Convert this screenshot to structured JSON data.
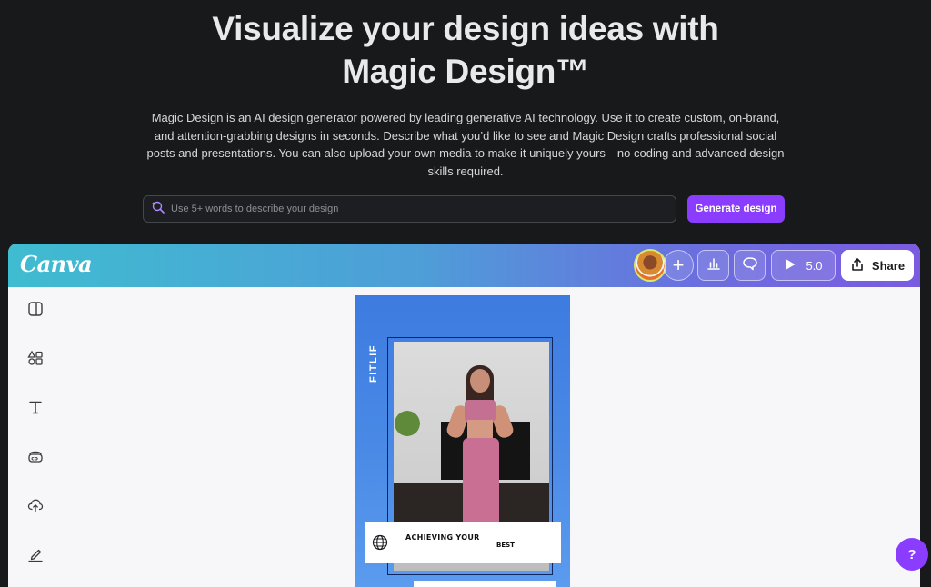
{
  "hero": {
    "title_line1": "Visualize your design ideas with",
    "title_line2": "Magic Design™",
    "description": "Magic Design is an AI design generator powered by leading generative AI technology. Use it to create custom, on-brand, and attention-grabbing designs in seconds. Describe what you’d like to see and Magic Design crafts professional social posts and presentations. You can also upload your own media to make it uniquely yours—no coding and advanced design skills required."
  },
  "prompt": {
    "placeholder": "Use 5+ words to describe your design",
    "icon": "magic-search-icon"
  },
  "generate_button": {
    "label": "Generate design"
  },
  "editor": {
    "logo": "Canva",
    "header": {
      "add_label": "+",
      "present_value": "5.0",
      "share_label": "Share"
    },
    "sidebar_icons": [
      "layout-icon",
      "elements-icon",
      "text-icon",
      "brand-icon",
      "upload-icon",
      "draw-icon"
    ],
    "design": {
      "brand": "FITLIF",
      "caption_line1": "ACHIEVING YOUR",
      "caption_line2": "BEST"
    }
  },
  "help_button": {
    "label": "?"
  },
  "colors": {
    "background": "#18191b",
    "accent": "#8b3dff",
    "header_gradient_start": "#3fbcd0",
    "header_gradient_end": "#7a5be0",
    "design_blue": "#4a8ae6"
  }
}
